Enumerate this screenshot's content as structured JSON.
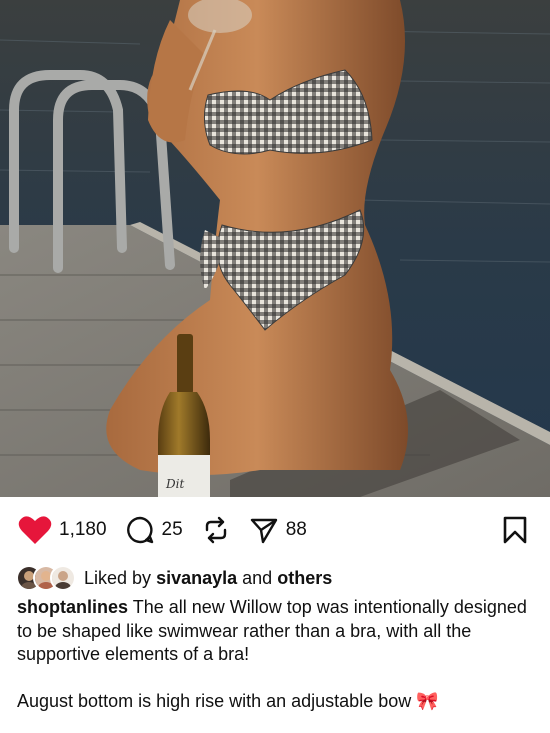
{
  "post": {
    "image": {
      "description_icon": "photo"
    },
    "bottle_label": "Dit"
  },
  "actions": {
    "like_count": "1,180",
    "comment_count": "25",
    "share_count": "88",
    "like_color": "#e6163b"
  },
  "likes": {
    "prefix": "Liked by",
    "user": "sivanayla",
    "and": "and",
    "others": "others"
  },
  "caption": {
    "username": "shoptanlines",
    "text": "The all new Willow top was intentionally designed to be shaped like swimwear rather than a bra, with all the supportive elements of a bra!",
    "second_paragraph": "August bottom is high rise with an adjustable bow",
    "emoji": "🎀"
  }
}
